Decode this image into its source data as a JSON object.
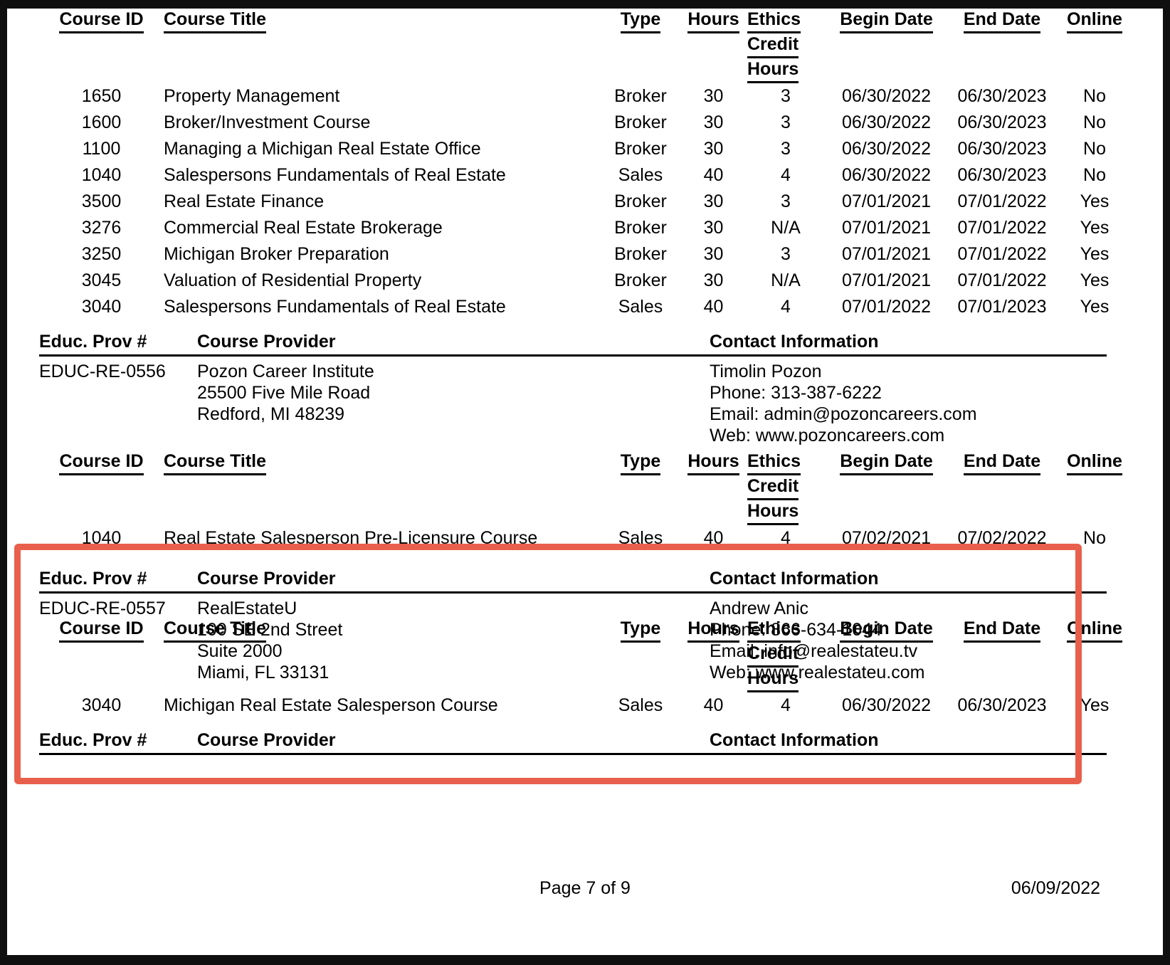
{
  "document": {
    "columns": {
      "course_id": "Course ID",
      "course_title": "Course Title",
      "type": "Type",
      "hours": "Hours",
      "ethics_line1": "Ethics ",
      "ethics_line2": "Credit ",
      "ethics_line3": "Hours",
      "begin_date": "Begin Date",
      "end_date": "End Date",
      "online": "Online"
    },
    "provider_columns": {
      "educ_prov": "Educ. Prov #",
      "course_provider": "Course Provider",
      "contact_information": "Contact Information"
    },
    "top_courses": [
      {
        "id": "1650",
        "title": "Property Management",
        "type": "Broker",
        "hours": "30",
        "ethics": "3",
        "begin": "06/30/2022",
        "end": "06/30/2023",
        "online": "No"
      },
      {
        "id": "1600",
        "title": "Broker/Investment Course",
        "type": "Broker",
        "hours": "30",
        "ethics": "3",
        "begin": "06/30/2022",
        "end": "06/30/2023",
        "online": "No"
      },
      {
        "id": "1100",
        "title": "Managing a Michigan Real Estate Office",
        "type": "Broker",
        "hours": "30",
        "ethics": "3",
        "begin": "06/30/2022",
        "end": "06/30/2023",
        "online": "No"
      },
      {
        "id": "1040",
        "title": "Salespersons Fundamentals of Real Estate",
        "type": "Sales",
        "hours": "40",
        "ethics": "4",
        "begin": "06/30/2022",
        "end": "06/30/2023",
        "online": "No"
      },
      {
        "id": "3500",
        "title": "Real Estate Finance",
        "type": "Broker",
        "hours": "30",
        "ethics": "3",
        "begin": "07/01/2021",
        "end": "07/01/2022",
        "online": "Yes"
      },
      {
        "id": "3276",
        "title": "Commercial Real Estate Brokerage",
        "type": "Broker",
        "hours": "30",
        "ethics": "N/A",
        "begin": "07/01/2021",
        "end": "07/01/2022",
        "online": "Yes"
      },
      {
        "id": "3250",
        "title": "Michigan Broker Preparation",
        "type": "Broker",
        "hours": "30",
        "ethics": "3",
        "begin": "07/01/2021",
        "end": "07/01/2022",
        "online": "Yes"
      },
      {
        "id": "3045",
        "title": "Valuation of Residential Property",
        "type": "Broker",
        "hours": "30",
        "ethics": "N/A",
        "begin": "07/01/2021",
        "end": "07/01/2022",
        "online": "Yes"
      },
      {
        "id": "3040",
        "title": "Salespersons Fundamentals of Real Estate",
        "type": "Sales",
        "hours": "40",
        "ethics": "4",
        "begin": "07/01/2022",
        "end": "07/01/2023",
        "online": "Yes"
      }
    ],
    "provider_1": {
      "educ_prov_number": "EDUC-RE-0556",
      "name": "Pozon Career Institute",
      "address_line1": "25500 Five Mile Road",
      "address_line2": "Redford, MI 48239",
      "contact_name": "Timolin Pozon",
      "phone": "Phone: 313-387-6222",
      "email": "Email: admin@pozoncareers.com",
      "web": "Web: www.pozoncareers.com",
      "courses": [
        {
          "id": "1040",
          "title": "Real Estate Salesperson Pre-Licensure Course",
          "type": "Sales",
          "hours": "40",
          "ethics": "4",
          "begin": "07/02/2021",
          "end": "07/02/2022",
          "online": "No"
        }
      ]
    },
    "provider_2": {
      "educ_prov_number": "EDUC-RE-0557",
      "name": "RealEstateU",
      "address_line1": "100 SE 2nd Street",
      "address_line2": "Suite 2000",
      "address_line3": "Miami, FL 33131",
      "contact_name": "Andrew Anic",
      "phone": "Phone: 866-634-1044",
      "email": "Email: info@realestateu.tv",
      "web": "Web: www.realestateu.com",
      "courses": [
        {
          "id": "3040",
          "title": "Michigan Real Estate Salesperson Course",
          "type": "Sales",
          "hours": "40",
          "ethics": "4",
          "begin": "06/30/2022",
          "end": "06/30/2023",
          "online": "Yes"
        }
      ]
    },
    "provider_3_partial": {
      "educ_prov": "Educ. Prov #",
      "course_provider": "Course Provider",
      "contact_information": "Contact Information"
    },
    "footer": {
      "page_label": "Page 7 of 9",
      "date": "06/09/2022"
    },
    "highlight_color": "#e8604c"
  }
}
